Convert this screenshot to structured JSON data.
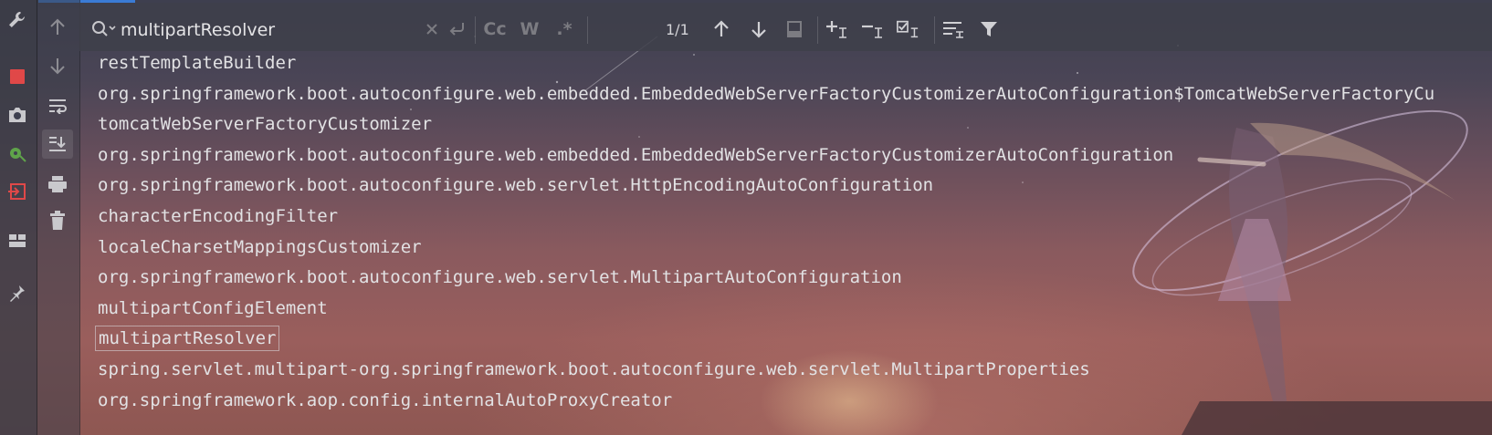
{
  "search": {
    "query": "multipartResolver",
    "match_count": "1/1",
    "case_label": "Cc",
    "word_label": "W",
    "regex_label": ".*"
  },
  "console": {
    "lines": [
      "restTemplateBuilder",
      "org.springframework.boot.autoconfigure.web.embedded.EmbeddedWebServerFactoryCustomizerAutoConfiguration$TomcatWebServerFactoryCu",
      "tomcatWebServerFactoryCustomizer",
      "org.springframework.boot.autoconfigure.web.embedded.EmbeddedWebServerFactoryCustomizerAutoConfiguration",
      "org.springframework.boot.autoconfigure.web.servlet.HttpEncodingAutoConfiguration",
      "characterEncodingFilter",
      "localeCharsetMappingsCustomizer",
      "org.springframework.boot.autoconfigure.web.servlet.MultipartAutoConfiguration",
      "multipartConfigElement",
      "multipartResolver",
      "spring.servlet.multipart-org.springframework.boot.autoconfigure.web.servlet.MultipartProperties",
      "org.springframework.aop.config.internalAutoProxyCreator"
    ],
    "highlighted_index": 9
  },
  "colors": {
    "accent": "#3a7bd5",
    "stop": "#e04848",
    "rerun": "#5fa34a"
  },
  "icons": {
    "left_toolbar": [
      "wrench-icon",
      "stop-icon",
      "camera-icon",
      "rerun-debug-icon",
      "exit-icon",
      "layout-icon",
      "pin-icon"
    ],
    "gutter": [
      "arrow-up-icon",
      "arrow-down-icon",
      "soft-wrap-icon",
      "scroll-to-end-icon",
      "print-icon",
      "trash-icon"
    ],
    "search_bar": [
      "search-icon",
      "clear-icon",
      "replace-icon",
      "prev-occurrence-icon",
      "next-occurrence-icon",
      "filter-results-icon",
      "add-selection-icon",
      "remove-selection-icon",
      "select-all-occurrences-icon",
      "filter-options-icon",
      "funnel-icon"
    ]
  }
}
